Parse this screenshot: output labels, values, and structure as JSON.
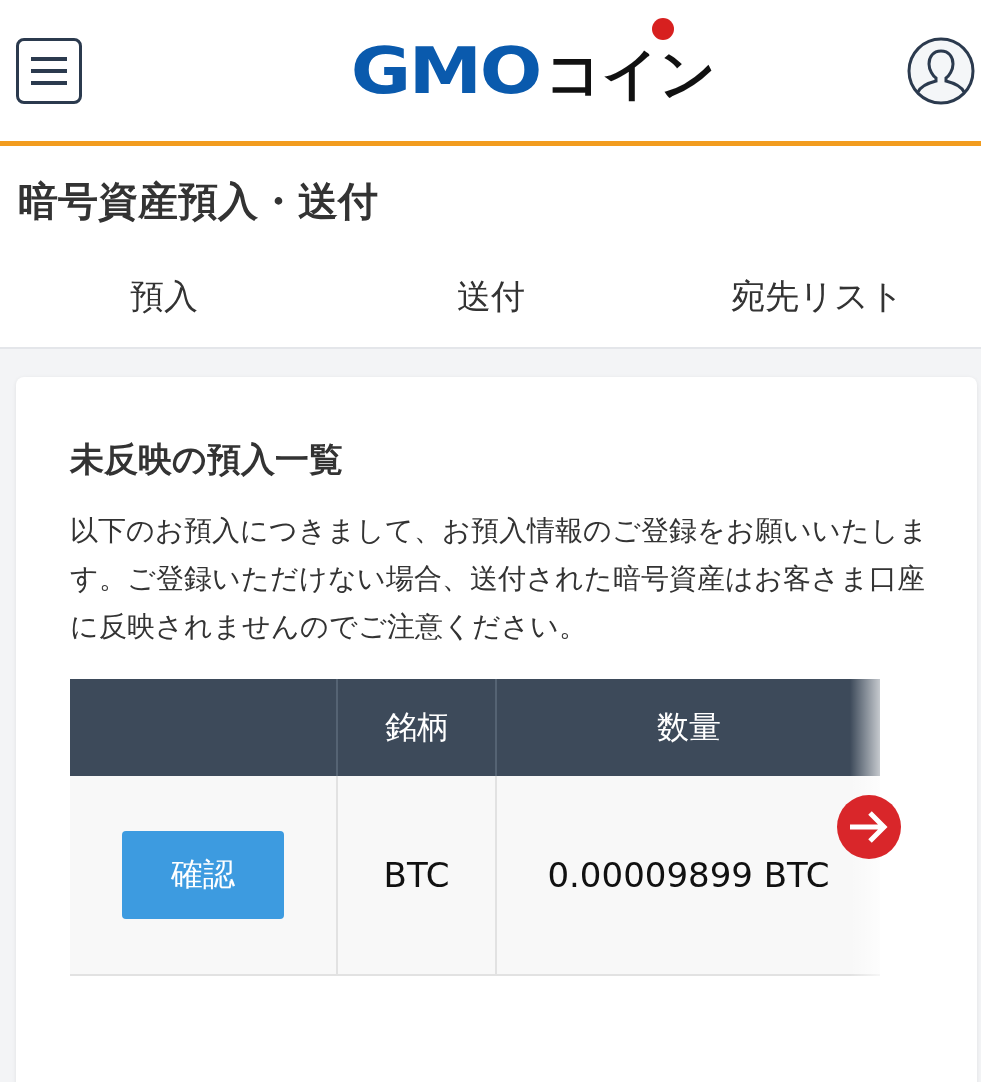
{
  "header": {
    "logo_primary": "GMO",
    "logo_secondary": "コイン"
  },
  "page_title": "暗号資産預入・送付",
  "tabs": [
    {
      "label": "預入"
    },
    {
      "label": "送付"
    },
    {
      "label": "宛先リスト"
    }
  ],
  "card": {
    "title": "未反映の預入一覧",
    "description": "以下のお預入につきまして、お預入情報のご登録をお願いいたします。ご登録いただけない場合、送付された暗号資産はお客さま口座に反映されませんのでご注意ください。",
    "table": {
      "columns": [
        "",
        "銘柄",
        "数量"
      ],
      "rows": [
        {
          "action": "確認",
          "symbol": "BTC",
          "amount": "0.00009899 BTC"
        }
      ]
    }
  }
}
